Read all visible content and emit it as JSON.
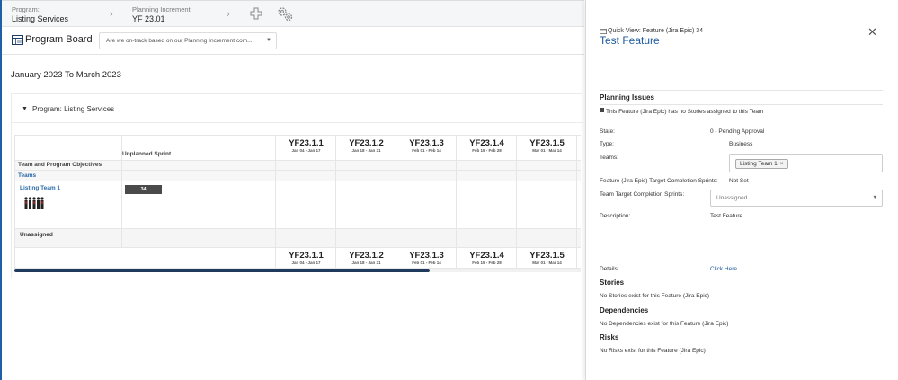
{
  "breadcrumbs": {
    "program_label": "Program:",
    "program_value": "Listing Services",
    "pi_label": "Planning Increment:",
    "pi_value": "YF 23.01"
  },
  "board": {
    "title": "Program Board",
    "question_select": "Are we on-track based on our Planning Increment com..."
  },
  "date_range": "January 2023 To March 2023",
  "program_section": "Program: Listing Services",
  "grid": {
    "unplanned_header": "Unplanned Sprint",
    "objectives_label": "Team and Program Objectives",
    "teams_label": "Teams",
    "team_name": "Listing Team 1",
    "team_count": "34",
    "unassigned_label": "Unassigned",
    "sprints": [
      {
        "name": "YF23.1.1",
        "dates": "Jan 04 - Jan 17"
      },
      {
        "name": "YF23.1.2",
        "dates": "Jan 18 - Jan 31"
      },
      {
        "name": "YF23.1.3",
        "dates": "Feb 01 - Feb 14"
      },
      {
        "name": "YF23.1.4",
        "dates": "Feb 15 - Feb 28"
      },
      {
        "name": "YF23.1.5",
        "dates": "Mar 01 - Mar 14"
      }
    ],
    "sprints_bottom": [
      {
        "name": "YF23.1.1",
        "dates": "Jan 04 - Jan 17"
      },
      {
        "name": "YF23.1.2",
        "dates": "Jan 18 - Jan 31"
      },
      {
        "name": "YF23.1.3",
        "dates": "Feb 01 - Feb 14"
      },
      {
        "name": "YF23.1.4",
        "dates": "Feb 15 - Feb 28"
      },
      {
        "name": "YF23.1.5",
        "dates": "Mar 01 - Mar 14"
      }
    ]
  },
  "quick_view": {
    "label": "Quick View: Feature (Jira Epic) 34",
    "title": "Test Feature",
    "planning_issues_title": "Planning Issues",
    "planning_issue": "This Feature (Jira Epic) has no Stories assigned to this Team",
    "state_label": "State:",
    "state_value": "0 - Pending Approval",
    "type_label": "Type:",
    "type_value": "Business",
    "teams_label": "Teams:",
    "teams_tag": "Listing Team 1",
    "target_label": "Feature (Jira Epic) Target Completion Sprints:",
    "target_value": "Not Set",
    "team_target_label": "Team Target Completion Sprints:",
    "team_target_placeholder": "Unassigned",
    "description_label": "Description:",
    "description_value": "Test Feature",
    "details_label": "Details:",
    "details_link": "Click Here",
    "stories_title": "Stories",
    "stories_text": "No Stories exist for this Feature (Jira Epic)",
    "dependencies_title": "Dependencies",
    "dependencies_text": "No Dependencies exist for this Feature (Jira Epic)",
    "risks_title": "Risks",
    "risks_text": "No Risks exist for this Feature (Jira Epic)"
  },
  "colors": {
    "accent": "#1d5a9b",
    "left_edge": "#1f5fa5",
    "count_bar": "#4a4a4a"
  },
  "icons": [
    "chevron-right-icon",
    "plus-icon",
    "gears-icon",
    "board-icon",
    "caret-down-icon",
    "collapse-triangle-icon",
    "close-icon",
    "quick-view-icon",
    "team-avatar-icon"
  ]
}
